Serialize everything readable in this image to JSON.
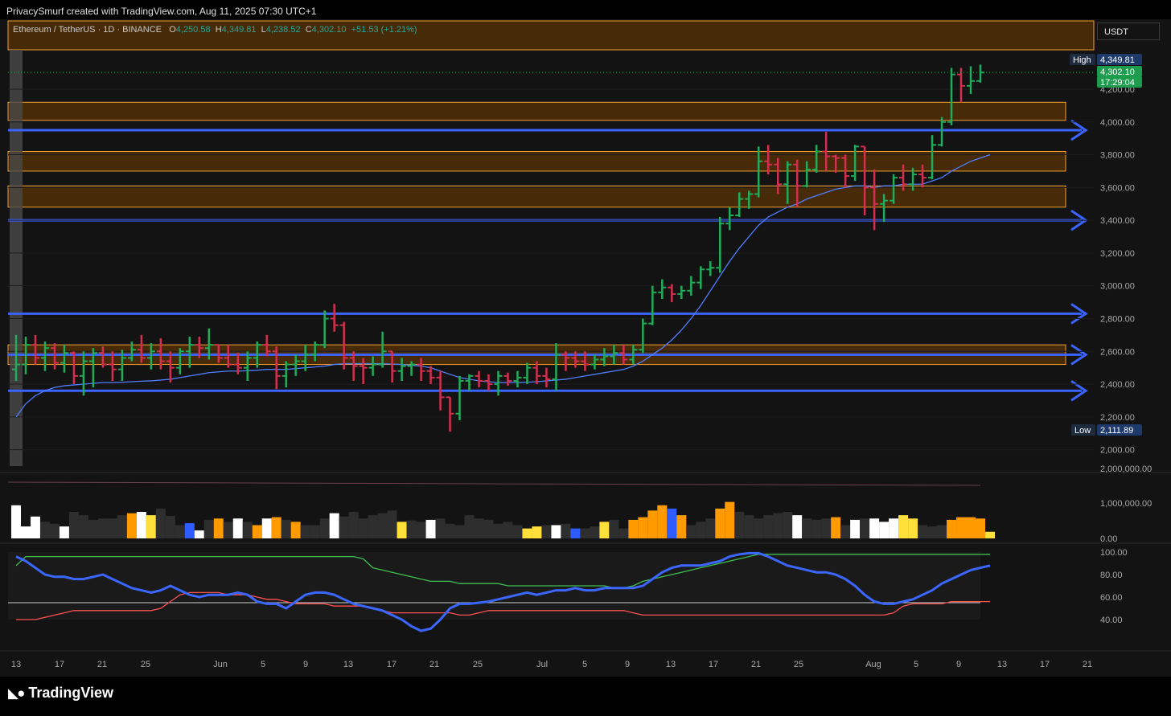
{
  "caption": "PrivacySmurf created with TradingView.com, Aug 11, 2025 07:30 UTC+1",
  "symbol": {
    "name": "Ethereum / TetherUS · 1D · BINANCE",
    "o_label": "O",
    "o": "4,250.58",
    "h_label": "H",
    "h": "4,349.81",
    "l_label": "L",
    "l": "4,238.52",
    "c_label": "C",
    "c": "4,302.10",
    "change": "+51.53 (+1.21%)"
  },
  "currency": "USDT",
  "brand": "TradingView",
  "price_axis": {
    "ticks": [
      "4,200.00",
      "4,000.00",
      "3,800.00",
      "3,600.00",
      "3,400.00",
      "3,200.00",
      "3,000.00",
      "2,800.00",
      "2,600.00",
      "2,400.00",
      "2,200.00",
      "2,000.00"
    ],
    "high_label": "High",
    "high_value": "4,349.81",
    "last_value": "4,302.10",
    "countdown": "17:29:04",
    "low_label": "Low",
    "low_value": "2,111.89"
  },
  "volume_axis": {
    "ticks": [
      "2,000,000.00",
      "1,000,000.00",
      "0.00"
    ]
  },
  "osc_axis": {
    "ticks": [
      "100.00",
      "80.00",
      "60.00",
      "40.00"
    ]
  },
  "time_axis": {
    "ticks": [
      "13",
      "17",
      "21",
      "25",
      "Jun",
      "5",
      "9",
      "13",
      "17",
      "21",
      "25",
      "Jul",
      "5",
      "9",
      "13",
      "17",
      "21",
      "25",
      "Aug",
      "5",
      "9",
      "13",
      "17",
      "21"
    ]
  },
  "colors": {
    "up": "#22ab5a",
    "down": "#d32f4f",
    "zone_fill": "#5a3306",
    "zone_border": "#f0a030",
    "level_line": "#3b63ff",
    "ma": "#4f7fff",
    "osc": "#3b66ff",
    "osc_green": "#3fbf4f",
    "osc_red": "#ff5050"
  },
  "chart_data": {
    "type": "candlestick",
    "x_start": "2025-05-12",
    "x_end": "2025-08-11",
    "ylim": [
      1900,
      4450
    ],
    "ohlc": [
      [
        2490,
        2700,
        2420,
        2520
      ],
      [
        2520,
        2690,
        2460,
        2640
      ],
      [
        2640,
        2700,
        2520,
        2560
      ],
      [
        2560,
        2660,
        2480,
        2620
      ],
      [
        2620,
        2650,
        2490,
        2530
      ],
      [
        2530,
        2640,
        2470,
        2590
      ],
      [
        2590,
        2600,
        2400,
        2450
      ],
      [
        2450,
        2600,
        2330,
        2540
      ],
      [
        2540,
        2620,
        2380,
        2590
      ],
      [
        2590,
        2630,
        2500,
        2520
      ],
      [
        2520,
        2600,
        2420,
        2490
      ],
      [
        2490,
        2610,
        2420,
        2560
      ],
      [
        2560,
        2660,
        2540,
        2610
      ],
      [
        2610,
        2700,
        2530,
        2560
      ],
      [
        2560,
        2650,
        2490,
        2600
      ],
      [
        2600,
        2680,
        2490,
        2540
      ],
      [
        2540,
        2600,
        2410,
        2500
      ],
      [
        2500,
        2620,
        2460,
        2600
      ],
      [
        2600,
        2690,
        2500,
        2640
      ],
      [
        2640,
        2690,
        2560,
        2620
      ],
      [
        2620,
        2740,
        2550,
        2640
      ],
      [
        2640,
        2640,
        2530,
        2560
      ],
      [
        2560,
        2640,
        2500,
        2520
      ],
      [
        2520,
        2590,
        2460,
        2500
      ],
      [
        2500,
        2600,
        2420,
        2560
      ],
      [
        2560,
        2660,
        2500,
        2640
      ],
      [
        2640,
        2700,
        2570,
        2600
      ],
      [
        2600,
        2630,
        2370,
        2450
      ],
      [
        2450,
        2540,
        2380,
        2520
      ],
      [
        2520,
        2580,
        2450,
        2540
      ],
      [
        2540,
        2640,
        2480,
        2580
      ],
      [
        2580,
        2660,
        2540,
        2640
      ],
      [
        2640,
        2850,
        2620,
        2800
      ],
      [
        2800,
        2890,
        2720,
        2760
      ],
      [
        2760,
        2780,
        2490,
        2560
      ],
      [
        2560,
        2600,
        2420,
        2510
      ],
      [
        2510,
        2560,
        2400,
        2500
      ],
      [
        2500,
        2570,
        2450,
        2520
      ],
      [
        2520,
        2720,
        2500,
        2600
      ],
      [
        2600,
        2600,
        2410,
        2480
      ],
      [
        2480,
        2560,
        2420,
        2510
      ],
      [
        2510,
        2540,
        2450,
        2520
      ],
      [
        2520,
        2560,
        2420,
        2480
      ],
      [
        2480,
        2510,
        2400,
        2440
      ],
      [
        2440,
        2480,
        2240,
        2320
      ],
      [
        2320,
        2320,
        2110,
        2220
      ],
      [
        2220,
        2450,
        2180,
        2420
      ],
      [
        2420,
        2460,
        2360,
        2450
      ],
      [
        2450,
        2480,
        2380,
        2420
      ],
      [
        2420,
        2460,
        2360,
        2400
      ],
      [
        2400,
        2480,
        2330,
        2450
      ],
      [
        2450,
        2470,
        2390,
        2420
      ],
      [
        2420,
        2480,
        2380,
        2440
      ],
      [
        2440,
        2530,
        2400,
        2500
      ],
      [
        2500,
        2540,
        2400,
        2450
      ],
      [
        2450,
        2500,
        2380,
        2430
      ],
      [
        2430,
        2650,
        2360,
        2580
      ],
      [
        2580,
        2600,
        2480,
        2560
      ],
      [
        2560,
        2600,
        2500,
        2540
      ],
      [
        2540,
        2600,
        2480,
        2520
      ],
      [
        2520,
        2580,
        2490,
        2550
      ],
      [
        2550,
        2620,
        2510,
        2570
      ],
      [
        2570,
        2640,
        2520,
        2590
      ],
      [
        2590,
        2640,
        2520,
        2550
      ],
      [
        2550,
        2640,
        2520,
        2610
      ],
      [
        2610,
        2800,
        2590,
        2770
      ],
      [
        2770,
        3000,
        2760,
        2960
      ],
      [
        2960,
        3040,
        2920,
        2990
      ],
      [
        2990,
        3010,
        2900,
        2950
      ],
      [
        2950,
        3000,
        2920,
        2970
      ],
      [
        2970,
        3060,
        2940,
        3020
      ],
      [
        3020,
        3120,
        2980,
        3100
      ],
      [
        3100,
        3150,
        3060,
        3110
      ],
      [
        3110,
        3420,
        3080,
        3380
      ],
      [
        3380,
        3480,
        3340,
        3430
      ],
      [
        3430,
        3570,
        3420,
        3530
      ],
      [
        3530,
        3580,
        3470,
        3560
      ],
      [
        3560,
        3850,
        3540,
        3760
      ],
      [
        3760,
        3860,
        3680,
        3740
      ],
      [
        3740,
        3780,
        3560,
        3620
      ],
      [
        3620,
        3760,
        3500,
        3740
      ],
      [
        3740,
        3770,
        3480,
        3610
      ],
      [
        3610,
        3760,
        3600,
        3710
      ],
      [
        3710,
        3860,
        3690,
        3820
      ],
      [
        3820,
        3940,
        3700,
        3790
      ],
      [
        3790,
        3800,
        3690,
        3780
      ],
      [
        3780,
        3800,
        3600,
        3670
      ],
      [
        3670,
        3860,
        3640,
        3850
      ],
      [
        3850,
        3850,
        3430,
        3600
      ],
      [
        3600,
        3710,
        3340,
        3500
      ],
      [
        3500,
        3560,
        3390,
        3520
      ],
      [
        3520,
        3680,
        3500,
        3660
      ],
      [
        3660,
        3740,
        3580,
        3620
      ],
      [
        3620,
        3720,
        3580,
        3680
      ],
      [
        3680,
        3740,
        3600,
        3660
      ],
      [
        3660,
        3920,
        3650,
        3860
      ],
      [
        3860,
        4030,
        3850,
        4000
      ],
      [
        4000,
        4330,
        3980,
        4290
      ],
      [
        4290,
        4330,
        4120,
        4220
      ],
      [
        4220,
        4340,
        4170,
        4250
      ],
      [
        4250,
        4350,
        4240,
        4302
      ]
    ],
    "moving_average": [
      2200,
      2280,
      2330,
      2360,
      2380,
      2390,
      2395,
      2400,
      2405,
      2410,
      2410,
      2412,
      2415,
      2418,
      2420,
      2425,
      2430,
      2440,
      2450,
      2460,
      2470,
      2475,
      2480,
      2480,
      2482,
      2485,
      2490,
      2490,
      2490,
      2495,
      2500,
      2505,
      2510,
      2520,
      2525,
      2525,
      2525,
      2525,
      2525,
      2522,
      2520,
      2515,
      2510,
      2500,
      2480,
      2460,
      2440,
      2430,
      2420,
      2415,
      2410,
      2410,
      2410,
      2412,
      2415,
      2420,
      2425,
      2430,
      2440,
      2450,
      2460,
      2470,
      2480,
      2490,
      2510,
      2540,
      2580,
      2620,
      2670,
      2730,
      2800,
      2880,
      2970,
      3060,
      3150,
      3230,
      3300,
      3370,
      3420,
      3450,
      3480,
      3500,
      3530,
      3550,
      3570,
      3590,
      3600,
      3610,
      3610,
      3600,
      3610,
      3610,
      3620,
      3620,
      3620,
      3640,
      3660,
      3700,
      3730,
      3760,
      3780,
      3800
    ],
    "resistance_zones": [
      [
        4010,
        4120
      ],
      [
        3700,
        3820
      ],
      [
        3480,
        3610
      ],
      [
        2520,
        2640
      ]
    ],
    "levels": [
      3950,
      3400,
      2830,
      2580,
      2360
    ],
    "volume_ticks_max": 2000000,
    "volume_levels": [
      0.5,
      0.18,
      0.33,
      0.25,
      0.22,
      0.18,
      0.4,
      0.35,
      0.28,
      0.3,
      0.3,
      0.35,
      0.38,
      0.4,
      0.35,
      0.45,
      0.34,
      0.2,
      0.23,
      0.12,
      0.28,
      0.3,
      0.25,
      0.3,
      0.25,
      0.2,
      0.3,
      0.32,
      0.28,
      0.25,
      0.2,
      0.2,
      0.3,
      0.38,
      0.33,
      0.4,
      0.3,
      0.35,
      0.38,
      0.42,
      0.25,
      0.27,
      0.25,
      0.28,
      0.3,
      0.22,
      0.2,
      0.35,
      0.3,
      0.28,
      0.22,
      0.25,
      0.2,
      0.15,
      0.18,
      0.2,
      0.2,
      0.22,
      0.15,
      0.15,
      0.18,
      0.25,
      0.28,
      0.15,
      0.28,
      0.32,
      0.42,
      0.5,
      0.45,
      0.35,
      0.2,
      0.25,
      0.3,
      0.45,
      0.55,
      0.4,
      0.35,
      0.3,
      0.35,
      0.38,
      0.4,
      0.35,
      0.3,
      0.28,
      0.3,
      0.32,
      0.2,
      0.28,
      0.3,
      0.3,
      0.25,
      0.3,
      0.35,
      0.3,
      0.2,
      0.18,
      0.2,
      0.28,
      0.32,
      0.32,
      0.3,
      0.1
    ],
    "volume_colors": [
      "w",
      "w",
      "w",
      "d",
      "d",
      "w",
      "d",
      "d",
      "d",
      "d",
      "d",
      "d",
      "o",
      "w",
      "y",
      "d",
      "d",
      "d",
      "b",
      "w",
      "d",
      "o",
      "d",
      "w",
      "d",
      "o",
      "w",
      "o",
      "d",
      "o",
      "d",
      "d",
      "d",
      "w",
      "d",
      "d",
      "d",
      "d",
      "d",
      "d",
      "y",
      "d",
      "d",
      "w",
      "d",
      "d",
      "d",
      "d",
      "d",
      "d",
      "d",
      "d",
      "d",
      "y",
      "y",
      "d",
      "w",
      "d",
      "b",
      "d",
      "d",
      "y",
      "d",
      "d",
      "o",
      "o",
      "o",
      "o",
      "b",
      "o",
      "d",
      "d",
      "d",
      "o",
      "o",
      "d",
      "d",
      "d",
      "d",
      "d",
      "d",
      "w",
      "d",
      "d",
      "d",
      "o",
      "d",
      "w",
      "d",
      "w",
      "w",
      "w",
      "y",
      "y",
      "d",
      "d",
      "d",
      "o",
      "o",
      "o",
      "o",
      "y"
    ],
    "oscillator": [
      96,
      92,
      86,
      80,
      78,
      78,
      76,
      76,
      78,
      80,
      76,
      72,
      68,
      66,
      64,
      66,
      70,
      66,
      62,
      60,
      62,
      62,
      62,
      64,
      62,
      56,
      54,
      54,
      50,
      56,
      62,
      64,
      64,
      62,
      58,
      54,
      52,
      50,
      48,
      44,
      40,
      34,
      30,
      32,
      40,
      50,
      54,
      54,
      55,
      56,
      58,
      60,
      62,
      64,
      62,
      64,
      66,
      66,
      68,
      66,
      66,
      68,
      68,
      68,
      68,
      70,
      76,
      82,
      86,
      88,
      88,
      88,
      90,
      92,
      96,
      98,
      99,
      99,
      96,
      92,
      88,
      86,
      84,
      82,
      82,
      80,
      76,
      70,
      62,
      56,
      54,
      54,
      56,
      58,
      62,
      66,
      72,
      76,
      80,
      84,
      86,
      88
    ],
    "osc_green_line": [
      88,
      96,
      96,
      96,
      96,
      96,
      96,
      96,
      96,
      96,
      96,
      96,
      96,
      96,
      96,
      96,
      96,
      96,
      96,
      96,
      96,
      96,
      96,
      96,
      96,
      96,
      96,
      96,
      96,
      96,
      96,
      96,
      96,
      96,
      96,
      96,
      94,
      86,
      84,
      82,
      80,
      78,
      76,
      74,
      74,
      74,
      72,
      72,
      72,
      72,
      72,
      70,
      70,
      70,
      70,
      70,
      70,
      70,
      70,
      70,
      70,
      70,
      68,
      68,
      70,
      74,
      76,
      78,
      80,
      82,
      84,
      86,
      88,
      90,
      92,
      94,
      96,
      98,
      98,
      98,
      98,
      98,
      98,
      98,
      98,
      98,
      98,
      98,
      98,
      98,
      98,
      98,
      98,
      98,
      98,
      98,
      98,
      98,
      98,
      98,
      98,
      98
    ],
    "osc_red_line": [
      40,
      40,
      40,
      42,
      44,
      46,
      48,
      48,
      48,
      48,
      48,
      48,
      48,
      48,
      48,
      50,
      56,
      62,
      64,
      64,
      64,
      64,
      62,
      62,
      62,
      60,
      58,
      58,
      56,
      54,
      54,
      54,
      54,
      52,
      52,
      52,
      52,
      50,
      48,
      46,
      46,
      46,
      46,
      46,
      46,
      46,
      44,
      44,
      46,
      48,
      48,
      48,
      48,
      48,
      48,
      48,
      48,
      48,
      48,
      48,
      48,
      48,
      48,
      48,
      46,
      44,
      44,
      44,
      44,
      44,
      44,
      44,
      44,
      44,
      44,
      44,
      44,
      44,
      44,
      44,
      44,
      44,
      44,
      44,
      44,
      44,
      44,
      44,
      44,
      44,
      44,
      46,
      52,
      54,
      54,
      54,
      54,
      56,
      56,
      56,
      56,
      56
    ],
    "osc_ylim": [
      30,
      105
    ],
    "osc_midline": 55
  }
}
